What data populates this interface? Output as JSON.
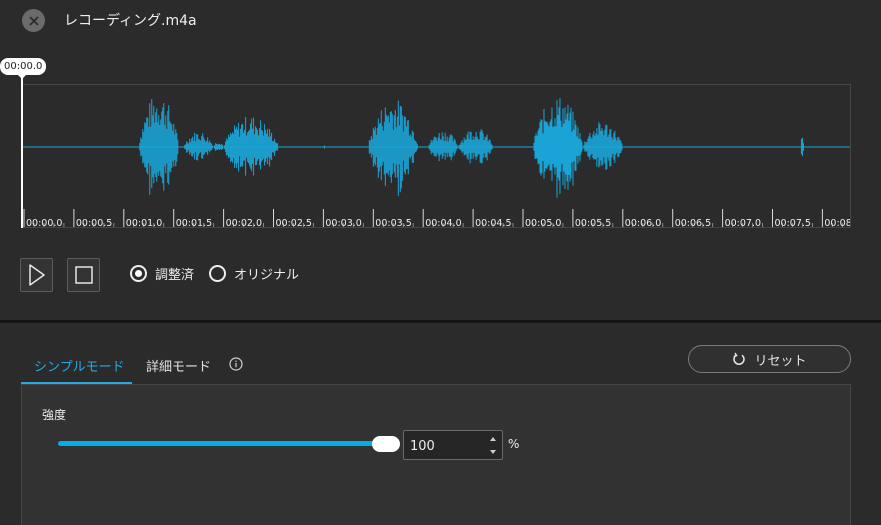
{
  "header": {
    "title": "レコーディング.m4a"
  },
  "playhead": {
    "time": "00:00.0"
  },
  "waveform": {
    "color": "#1aa6d9",
    "bursts": [
      {
        "start": 1.15,
        "end": 1.55,
        "amp": 0.95
      },
      {
        "start": 1.6,
        "end": 1.9,
        "amp": 0.28
      },
      {
        "start": 1.9,
        "end": 2.0,
        "amp": 0.12
      },
      {
        "start": 2.0,
        "end": 2.55,
        "amp": 0.55
      },
      {
        "start": 3.0,
        "end": 3.02,
        "amp": 0.05
      },
      {
        "start": 3.45,
        "end": 3.95,
        "amp": 0.85
      },
      {
        "start": 4.05,
        "end": 4.35,
        "amp": 0.3
      },
      {
        "start": 4.35,
        "end": 4.7,
        "amp": 0.35
      },
      {
        "start": 5.1,
        "end": 5.6,
        "amp": 0.9
      },
      {
        "start": 5.6,
        "end": 6.0,
        "amp": 0.45
      },
      {
        "start": 7.78,
        "end": 7.82,
        "amp": 0.2
      }
    ],
    "max_time": 8.0
  },
  "timeline": {
    "ticks": [
      "00:00.0",
      "00:00.5",
      "00:01.0",
      "00:01.5",
      "00:02.0",
      "00:02.5",
      "00:03.0",
      "00:03.5",
      "00:04.0",
      "00:04.5",
      "00:05.0",
      "00:05.5",
      "00:06.0",
      "00:06.5",
      "00:07.0",
      "00:07.5",
      "00:08."
    ]
  },
  "controls": {
    "radio_adjusted": "調整済",
    "radio_original": "オリジナル",
    "selected": "adjusted"
  },
  "tabs": {
    "simple": "シンプルモード",
    "detail": "詳細モード",
    "active": "simple",
    "accent": "#27a9e1"
  },
  "reset": {
    "label": "リセット"
  },
  "strength": {
    "label": "強度",
    "value": "100",
    "unit": "%",
    "level": 1.0
  }
}
